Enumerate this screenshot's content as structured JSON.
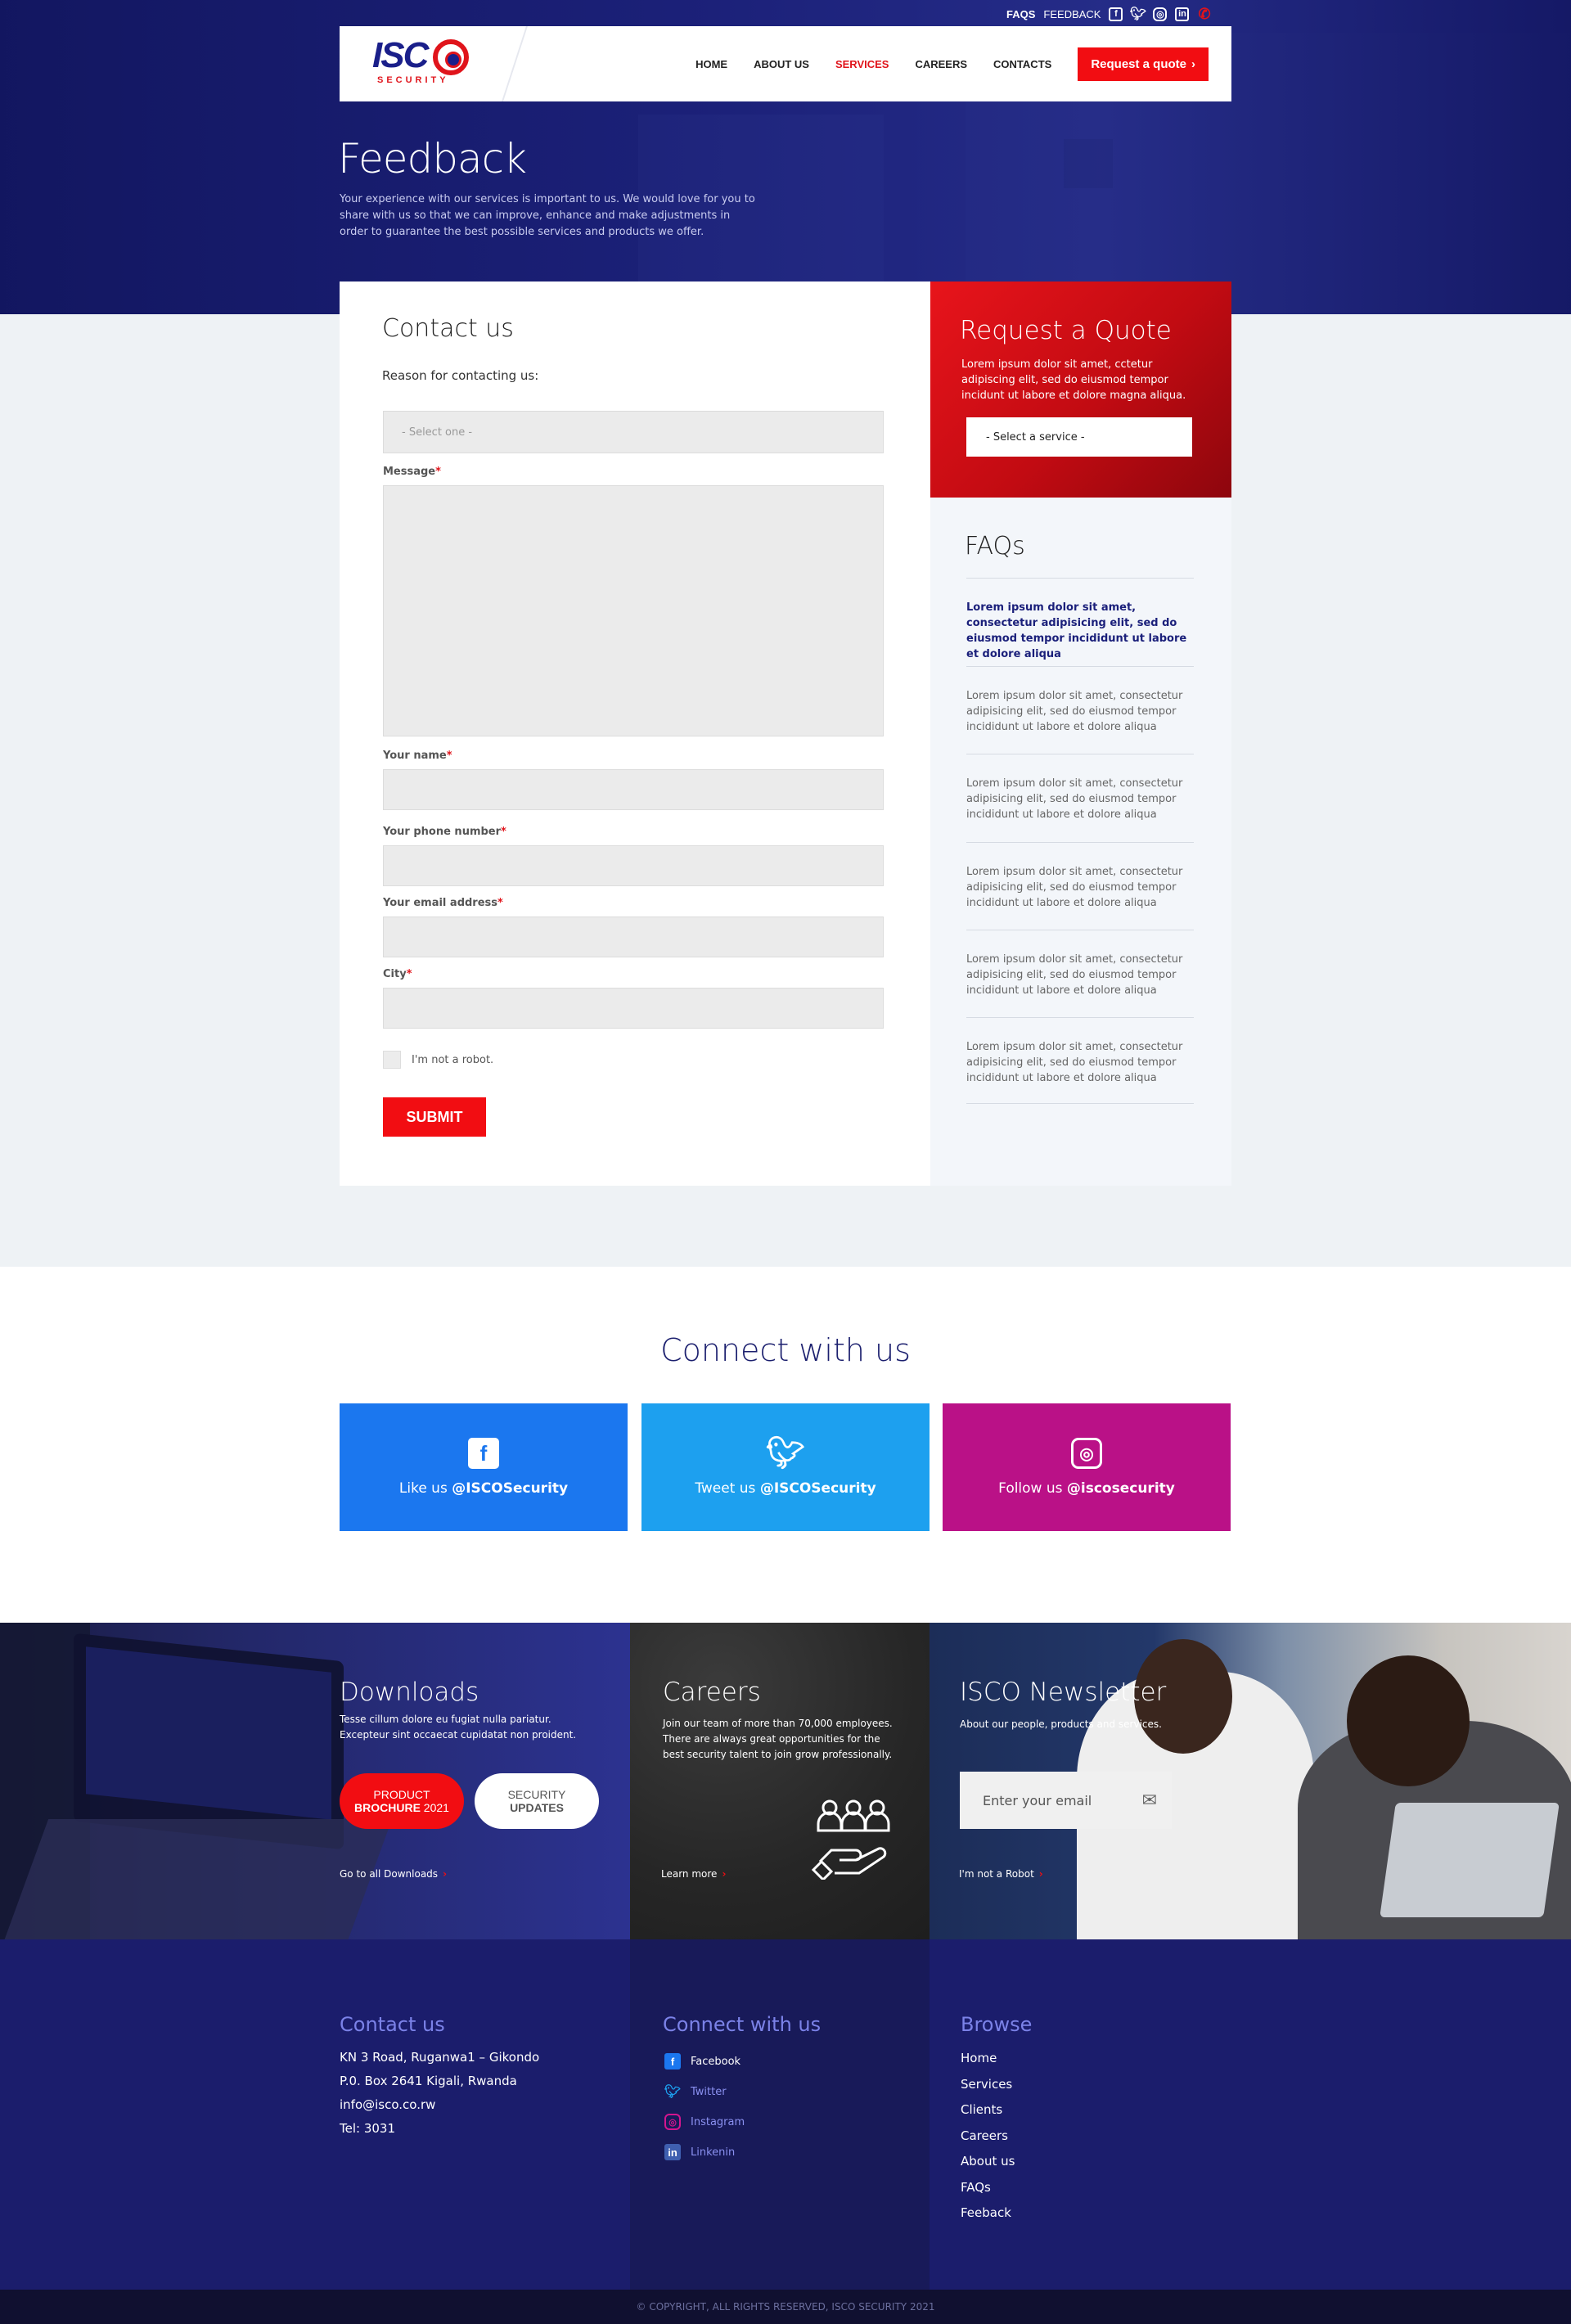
{
  "topbar": {
    "faqs": "FAQs",
    "feedback": "FEEDBACK",
    "icons": [
      "facebook-icon",
      "twitter-icon",
      "instagram-icon",
      "linkedin-icon",
      "phone-icon"
    ]
  },
  "brand": {
    "logo_text": "ISCO",
    "logo_sub": "SECURITY",
    "primary": "#1b1f7a",
    "accent": "#f20d12"
  },
  "nav": {
    "items": [
      {
        "label": "HOME",
        "active": false
      },
      {
        "label": "ABOUT US",
        "active": false
      },
      {
        "label": "SERVICES",
        "active": true
      },
      {
        "label": "CAREERS",
        "active": false
      },
      {
        "label": "CONTACTS",
        "active": false
      }
    ],
    "cta": "Request a quote"
  },
  "hero": {
    "title": "Feedback",
    "text": "Your experience with our services is important to us. We would love for you to share with us so that we can improve, enhance and make adjustments in order to guarantee the best possible services and products we offer."
  },
  "form": {
    "title": "Contact us",
    "reason_label": "Reason for contacting us:",
    "reason_placeholder": "- Select one -",
    "message_label": "Message",
    "name_label": "Your name",
    "phone_label": "Your phone number",
    "email_label": "Your email address",
    "city_label": "City",
    "required_mark": "*",
    "robot_label": "I'm not a robot.",
    "submit": "SUBMIT"
  },
  "quote": {
    "title": "Request a Quote",
    "text": "Lorem ipsum dolor sit amet, cctetur adipiscing elit, sed do eiusmod tempor incidunt ut labore et dolore magna aliqua.",
    "select": "- Select a service -"
  },
  "faqs": {
    "title": "FAQs",
    "items": [
      "Lorem ipsum dolor sit amet, consectetur adipisicing elit, sed do eiusmod tempor incididunt ut labore et dolore  aliqua",
      "Lorem ipsum dolor sit amet, consectetur adipisicing elit, sed do eiusmod tempor incididunt ut labore et dolore  aliqua",
      "Lorem ipsum dolor sit amet, consectetur adipisicing elit, sed do eiusmod tempor incididunt ut labore et dolore  aliqua",
      "Lorem ipsum dolor sit amet, consectetur adipisicing elit, sed do eiusmod tempor incididunt ut labore et dolore  aliqua",
      "Lorem ipsum dolor sit amet, consectetur adipisicing elit, sed do eiusmod tempor incididunt ut labore et dolore  aliqua",
      "Lorem ipsum dolor sit amet, consectetur adipisicing elit, sed do eiusmod tempor incididunt ut labore et dolore  aliqua"
    ]
  },
  "connect": {
    "title": "Connect with us",
    "cards": [
      {
        "icon": "facebook-icon",
        "prefix": "Like us ",
        "handle": "@ISCOSecurity",
        "color": "#1b77ef"
      },
      {
        "icon": "twitter-icon",
        "prefix": "Tweet us ",
        "handle": "@ISCOSecurity",
        "color": "#1da0ef"
      },
      {
        "icon": "instagram-icon",
        "prefix": "Follow us ",
        "handle": "@iscosecurity",
        "color": "#ba1187"
      }
    ]
  },
  "downloads": {
    "title": "Downloads",
    "text": "Tesse cillum dolore eu fugiat nulla pariatur. Excepteur sint occaecat cupidatat non proident.",
    "pill1_top": "PRODUCT",
    "pill1_bottom_bold": "BROCHURE",
    "pill1_bottom_year": " 2021",
    "pill2_top": "SECURITY",
    "pill2_bottom": "UPDATES",
    "link": "Go to all Downloads"
  },
  "careers": {
    "title": "Careers",
    "text": "Join our team of more than 70,000 employees. There are always great opportunities for the best security talent to join grow professionally.",
    "link": "Learn more",
    "icon": "team-hand-icon"
  },
  "newsletter": {
    "title": "ISCO Newsletter",
    "text": "About our people, products and services.",
    "placeholder": "Enter your email",
    "robot": "I'm not a Robot"
  },
  "footer": {
    "contact": {
      "title": "Contact us",
      "lines": [
        "KN 3 Road, Ruganwa1 – Gikondo",
        "P.0. Box 2641 Kigali, Rwanda",
        "info@isco.co.rw",
        "Tel: 3031"
      ]
    },
    "connect": {
      "title": "Connect with us",
      "items": [
        {
          "label": "Facebook",
          "icon": "facebook-icon",
          "color": "#1b77ef"
        },
        {
          "label": "Twitter",
          "icon": "twitter-icon",
          "color": "#1da0ef"
        },
        {
          "label": "Instagram",
          "icon": "instagram-icon",
          "color": "#d4158f"
        },
        {
          "label": "Linkenin",
          "icon": "linkedin-icon",
          "color": "#3f5fb0"
        }
      ]
    },
    "browse": {
      "title": "Browse",
      "links": [
        "Home",
        "Services",
        "Clients",
        "Careers",
        "About us",
        "FAQs",
        "Feeback"
      ]
    },
    "copyright": "© COPYRIGHT, ALL RIGHTS RESERVED, ISCO SECURITY 2021"
  }
}
